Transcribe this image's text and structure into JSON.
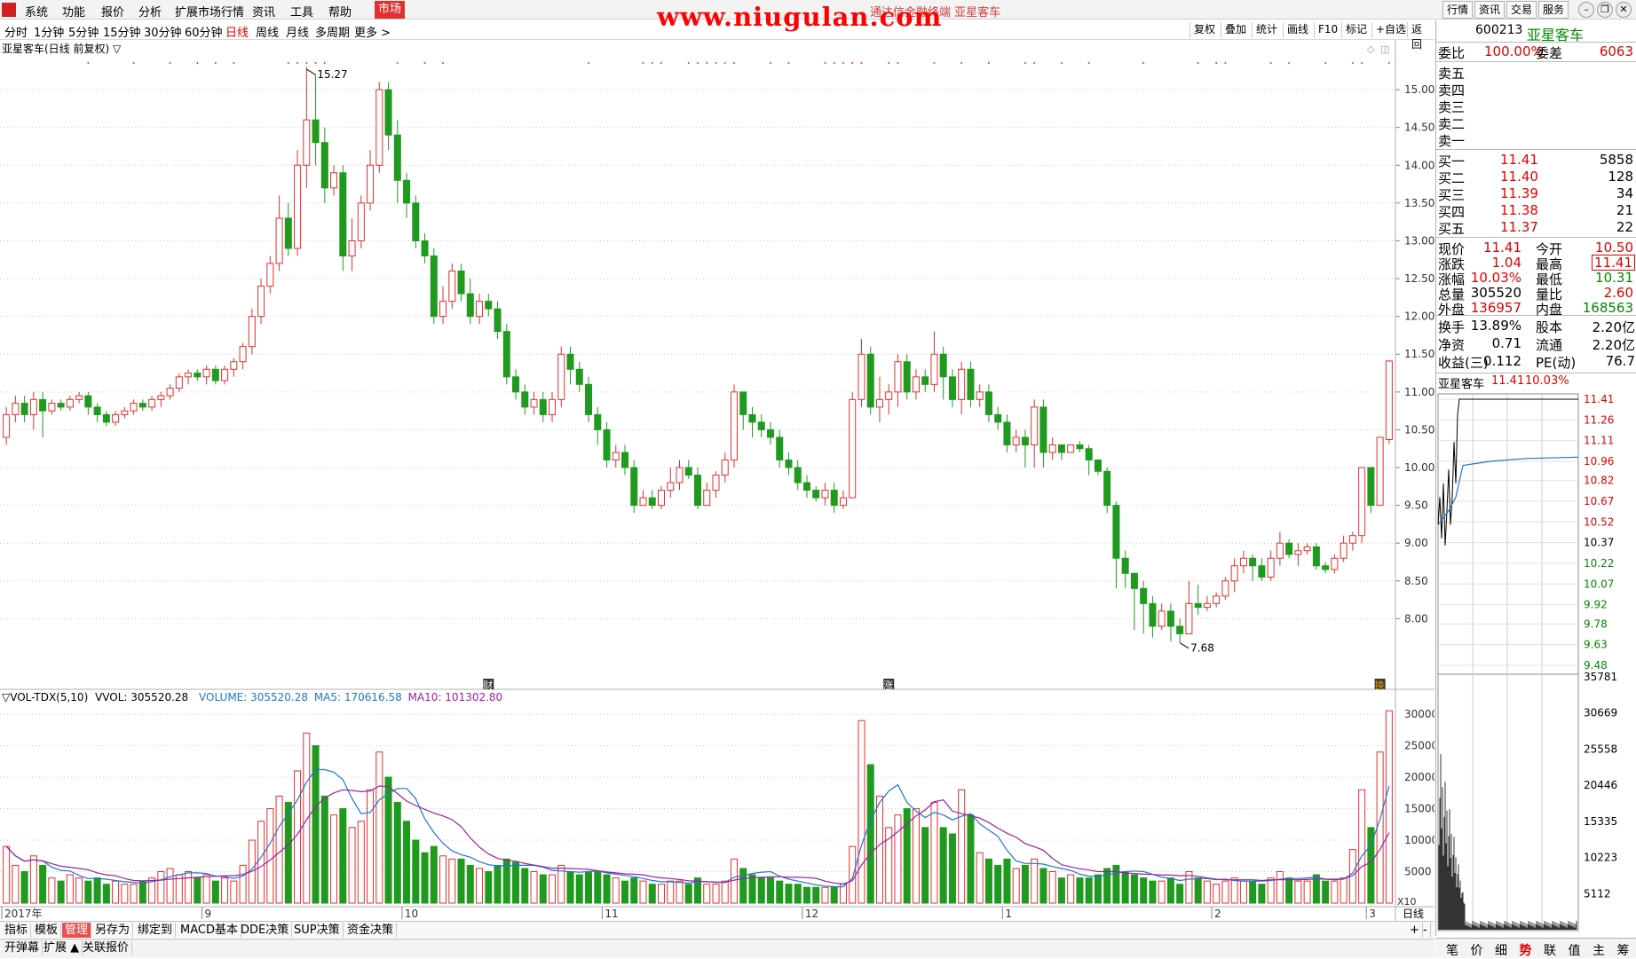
{
  "menu": {
    "items": [
      "系统",
      "功能",
      "报价",
      "分析",
      "扩展市场行情",
      "资讯",
      "工具",
      "帮助"
    ],
    "market": "市场",
    "watermark": "www.niugulan.com",
    "subtitle": "通达信金融终端 亚星客车",
    "right_buttons": [
      "行情",
      "资讯",
      "交易",
      "服务"
    ]
  },
  "toolbar": {
    "periods": [
      "分时",
      "1分钟",
      "5分钟",
      "15分钟",
      "30分钟",
      "60分钟",
      "日线",
      "周线",
      "月线",
      "多周期",
      "更多 >"
    ],
    "active_period": "日线",
    "tools": [
      "复权",
      "叠加",
      "统计",
      "画线",
      "F10",
      "标记",
      "+自选",
      "返回"
    ]
  },
  "chart_title": "亚星客车(日线 前复权) ▽",
  "annotations": {
    "high_label": "15.27",
    "low_label": "7.68",
    "markers": [
      "财",
      "涨",
      "换"
    ]
  },
  "axis": {
    "price_ticks": [
      "15.00",
      "14.50",
      "14.00",
      "13.50",
      "13.00",
      "12.50",
      "12.00",
      "11.50",
      "11.00",
      "10.50",
      "10.00",
      "9.50",
      "9.00",
      "8.50",
      "8.00"
    ],
    "vol_ticks": [
      "30000",
      "25000",
      "20000",
      "15000",
      "10000",
      "5000"
    ],
    "vol_unit": "X10",
    "date_labels": [
      "2017年",
      "9",
      "10",
      "11",
      "12",
      "1",
      "2",
      "3"
    ],
    "period_label": "日线"
  },
  "volume_legend": {
    "name": "▽VOL-TDX(5,10)",
    "vvol": "VVOL: 305520.28",
    "volume": "VOLUME: 305520.28",
    "ma5": "MA5: 170616.58",
    "ma10": "MA10: 101302.80",
    "colors": {
      "vvol": "#000000",
      "volume": "#1f77d0",
      "ma5": "#1f77d0",
      "ma10": "#a020a0"
    }
  },
  "quote": {
    "code": "600213",
    "name": "亚星客车",
    "weibi_label": "委比",
    "weibi": "100.00%",
    "weicha_label": "委差",
    "weicha": "6063",
    "sells": [
      {
        "label": "卖五",
        "price": "",
        "vol": ""
      },
      {
        "label": "卖四",
        "price": "",
        "vol": ""
      },
      {
        "label": "卖三",
        "price": "",
        "vol": ""
      },
      {
        "label": "卖二",
        "price": "",
        "vol": ""
      },
      {
        "label": "卖一",
        "price": "",
        "vol": ""
      }
    ],
    "buys": [
      {
        "label": "买一",
        "price": "11.41",
        "vol": "5858"
      },
      {
        "label": "买二",
        "price": "11.40",
        "vol": "128"
      },
      {
        "label": "买三",
        "price": "11.39",
        "vol": "34"
      },
      {
        "label": "买四",
        "price": "11.38",
        "vol": "21"
      },
      {
        "label": "买五",
        "price": "11.37",
        "vol": "22"
      }
    ],
    "stats": [
      {
        "l1": "现价",
        "v1": "11.41",
        "c1": "red",
        "l2": "今开",
        "v2": "10.50",
        "c2": "red"
      },
      {
        "l1": "涨跌",
        "v1": "1.04",
        "c1": "red",
        "l2": "最高",
        "v2": "11.41",
        "c2": "red"
      },
      {
        "l1": "涨幅",
        "v1": "10.03%",
        "c1": "red",
        "l2": "最低",
        "v2": "10.31",
        "c2": "green"
      },
      {
        "l1": "总量",
        "v1": "305520",
        "c1": "",
        "l2": "量比",
        "v2": "2.60",
        "c2": "red"
      },
      {
        "l1": "外盘",
        "v1": "136957",
        "c1": "red",
        "l2": "内盘",
        "v2": "168563",
        "c2": "green"
      }
    ],
    "stats2": [
      {
        "l1": "换手",
        "v1": "13.89%",
        "l2": "股本",
        "v2": "2.20亿"
      },
      {
        "l1": "净资",
        "v1": "0.71",
        "l2": "流通",
        "v2": "2.20亿"
      },
      {
        "l1": "收益(三)",
        "v1": "0.112",
        "l2": "PE(动)",
        "v2": "76.7"
      }
    ]
  },
  "mini": {
    "name": "亚星客车",
    "price": "11.41",
    "pct": "10.03%",
    "price_ticks": [
      "11.41",
      "11.26",
      "11.11",
      "10.96",
      "10.82",
      "10.67",
      "10.52",
      "10.37",
      "10.22",
      "10.07",
      "9.92",
      "9.78",
      "9.63",
      "9.48"
    ],
    "vol_ticks": [
      "35781",
      "30669",
      "25558",
      "20446",
      "15335",
      "10223",
      "5112"
    ]
  },
  "bottom": {
    "row1": [
      "指标",
      "模板",
      "管理",
      "另存为",
      "绑定到",
      "MACD基本",
      "DDE决策",
      "SUP决策",
      "资金决策"
    ],
    "row1_selected": "管理",
    "row2": [
      "开弹幕",
      "扩展 ▲",
      "关联报价"
    ],
    "right_tabs": [
      "笔",
      "价",
      "细",
      "势",
      "联",
      "值",
      "主",
      "筹"
    ],
    "right_tab_active": "势"
  },
  "chart_data": {
    "type": "candlestick",
    "title": "亚星客车(日线 前复权)",
    "ylim": [
      7.5,
      15.4
    ],
    "vol_ylim": [
      0,
      31000
    ],
    "highest": 15.27,
    "lowest": 7.68,
    "candles": [
      [
        10.4,
        10.7,
        10.3,
        10.8,
        9000
      ],
      [
        10.7,
        10.85,
        10.6,
        10.95,
        6000
      ],
      [
        10.85,
        10.7,
        10.6,
        10.95,
        5000
      ],
      [
        10.7,
        10.9,
        10.5,
        11.0,
        7500
      ],
      [
        10.9,
        10.75,
        10.4,
        11.0,
        6000
      ],
      [
        10.75,
        10.85,
        10.7,
        10.9,
        4000
      ],
      [
        10.85,
        10.8,
        10.75,
        10.9,
        3500
      ],
      [
        10.8,
        10.9,
        10.75,
        10.95,
        4500
      ],
      [
        10.9,
        10.95,
        10.85,
        11.0,
        4000
      ],
      [
        10.95,
        10.8,
        10.7,
        11.0,
        3500
      ],
      [
        10.8,
        10.7,
        10.6,
        10.85,
        4000
      ],
      [
        10.7,
        10.6,
        10.55,
        10.75,
        3000
      ],
      [
        10.6,
        10.7,
        10.55,
        10.75,
        3500
      ],
      [
        10.7,
        10.75,
        10.65,
        10.8,
        3000
      ],
      [
        10.75,
        10.85,
        10.7,
        10.9,
        3000
      ],
      [
        10.85,
        10.8,
        10.75,
        10.9,
        3500
      ],
      [
        10.8,
        10.9,
        10.75,
        10.95,
        4000
      ],
      [
        10.9,
        10.95,
        10.8,
        11.0,
        5000
      ],
      [
        10.95,
        11.05,
        10.9,
        11.1,
        5500
      ],
      [
        11.05,
        11.2,
        11.0,
        11.25,
        4500
      ],
      [
        11.2,
        11.25,
        11.1,
        11.3,
        5000
      ],
      [
        11.25,
        11.2,
        11.15,
        11.3,
        4000
      ],
      [
        11.2,
        11.3,
        11.1,
        11.35,
        4500
      ],
      [
        11.3,
        11.15,
        11.1,
        11.35,
        3500
      ],
      [
        11.15,
        11.3,
        11.1,
        11.35,
        4000
      ],
      [
        11.3,
        11.4,
        11.2,
        11.45,
        3500
      ],
      [
        11.4,
        11.6,
        11.3,
        11.65,
        6000
      ],
      [
        11.6,
        12.0,
        11.5,
        12.1,
        10000
      ],
      [
        12.0,
        12.4,
        11.9,
        12.5,
        13000
      ],
      [
        12.4,
        12.7,
        12.3,
        12.8,
        15000
      ],
      [
        12.7,
        13.3,
        12.6,
        13.6,
        17000
      ],
      [
        13.3,
        12.9,
        12.8,
        13.5,
        16000
      ],
      [
        12.9,
        14.0,
        12.8,
        14.2,
        21000
      ],
      [
        14.0,
        14.6,
        13.7,
        15.3,
        27000
      ],
      [
        14.6,
        14.3,
        14.0,
        15.2,
        25000
      ],
      [
        14.3,
        13.7,
        13.5,
        14.5,
        17000
      ],
      [
        13.7,
        13.9,
        13.6,
        14.0,
        14000
      ],
      [
        13.9,
        12.8,
        12.6,
        14.0,
        15000
      ],
      [
        12.8,
        13.0,
        12.6,
        13.3,
        12000
      ],
      [
        13.0,
        13.5,
        12.9,
        13.6,
        13000
      ],
      [
        13.5,
        14.0,
        13.4,
        14.2,
        18000
      ],
      [
        14.0,
        15.0,
        13.9,
        15.1,
        24000
      ],
      [
        15.0,
        14.4,
        14.2,
        15.1,
        20000
      ],
      [
        14.4,
        13.8,
        13.5,
        14.6,
        16000
      ],
      [
        13.8,
        13.5,
        13.3,
        13.9,
        13000
      ],
      [
        13.5,
        13.0,
        12.9,
        13.6,
        10000
      ],
      [
        13.0,
        12.8,
        12.7,
        13.1,
        8000
      ],
      [
        12.8,
        12.0,
        11.9,
        12.9,
        9000
      ],
      [
        12.0,
        12.2,
        11.9,
        12.4,
        7500
      ],
      [
        12.2,
        12.6,
        12.1,
        12.7,
        7000
      ],
      [
        12.6,
        12.3,
        12.2,
        12.7,
        7000
      ],
      [
        12.3,
        12.0,
        11.9,
        12.5,
        6000
      ],
      [
        12.0,
        12.2,
        11.9,
        12.3,
        5500
      ],
      [
        12.2,
        12.1,
        12.0,
        12.3,
        5000
      ],
      [
        12.1,
        11.8,
        11.7,
        12.2,
        6000
      ],
      [
        11.8,
        11.2,
        11.1,
        11.9,
        7000
      ],
      [
        11.2,
        11.0,
        10.9,
        11.3,
        6500
      ],
      [
        11.0,
        10.8,
        10.7,
        11.1,
        5500
      ],
      [
        10.8,
        10.9,
        10.7,
        11.0,
        5000
      ],
      [
        10.9,
        10.7,
        10.6,
        11.0,
        4500
      ],
      [
        10.7,
        10.9,
        10.6,
        11.0,
        4500
      ],
      [
        10.9,
        11.5,
        10.8,
        11.6,
        6000
      ],
      [
        11.5,
        11.3,
        11.1,
        11.6,
        5000
      ],
      [
        11.3,
        11.1,
        11.0,
        11.4,
        4500
      ],
      [
        11.1,
        10.7,
        10.6,
        11.2,
        5000
      ],
      [
        10.7,
        10.5,
        10.3,
        10.8,
        5000
      ],
      [
        10.5,
        10.1,
        10.0,
        10.6,
        4500
      ],
      [
        10.1,
        10.2,
        10.0,
        10.3,
        4000
      ],
      [
        10.2,
        10.0,
        9.9,
        10.3,
        3500
      ],
      [
        10.0,
        9.5,
        9.4,
        10.1,
        4000
      ],
      [
        9.5,
        9.6,
        9.5,
        9.7,
        3500
      ],
      [
        9.6,
        9.5,
        9.45,
        9.7,
        3000
      ],
      [
        9.5,
        9.7,
        9.45,
        9.75,
        3000
      ],
      [
        9.7,
        9.8,
        9.6,
        10.0,
        3500
      ],
      [
        9.8,
        10.0,
        9.7,
        10.1,
        3500
      ],
      [
        10.0,
        9.9,
        9.85,
        10.1,
        3000
      ],
      [
        9.9,
        9.5,
        9.45,
        10.0,
        4000
      ],
      [
        9.5,
        9.7,
        9.5,
        9.8,
        3000
      ],
      [
        9.7,
        9.9,
        9.6,
        9.95,
        3000
      ],
      [
        9.9,
        10.1,
        9.8,
        10.2,
        3500
      ],
      [
        10.1,
        11.0,
        10.0,
        11.1,
        7000
      ],
      [
        11.0,
        10.7,
        10.5,
        11.0,
        5500
      ],
      [
        10.7,
        10.6,
        10.4,
        10.8,
        4500
      ],
      [
        10.6,
        10.5,
        10.4,
        10.7,
        4000
      ],
      [
        10.5,
        10.4,
        10.3,
        10.6,
        4000
      ],
      [
        10.4,
        10.1,
        10.0,
        10.5,
        3500
      ],
      [
        10.1,
        10.0,
        9.9,
        10.2,
        3000
      ],
      [
        10.0,
        9.8,
        9.7,
        10.1,
        3000
      ],
      [
        9.8,
        9.7,
        9.6,
        9.9,
        2500
      ],
      [
        9.7,
        9.6,
        9.55,
        9.75,
        2500
      ],
      [
        9.6,
        9.7,
        9.5,
        9.8,
        2500
      ],
      [
        9.7,
        9.5,
        9.4,
        9.8,
        2500
      ],
      [
        9.5,
        9.6,
        9.45,
        9.7,
        3000
      ],
      [
        9.6,
        10.9,
        9.6,
        11.0,
        9000
      ],
      [
        10.9,
        11.5,
        10.8,
        11.7,
        29000
      ],
      [
        11.5,
        10.8,
        10.7,
        11.6,
        22000
      ],
      [
        10.8,
        10.9,
        10.6,
        11.2,
        17000
      ],
      [
        10.9,
        11.0,
        10.7,
        11.1,
        12000
      ],
      [
        11.0,
        11.4,
        10.8,
        11.5,
        14000
      ],
      [
        11.4,
        11.0,
        10.9,
        11.5,
        15000
      ],
      [
        11.0,
        11.2,
        10.9,
        11.3,
        15000
      ],
      [
        11.2,
        11.1,
        11.0,
        11.3,
        12000
      ],
      [
        11.1,
        11.5,
        11.0,
        11.8,
        16000
      ],
      [
        11.5,
        11.2,
        10.9,
        11.6,
        12000
      ],
      [
        11.2,
        10.9,
        10.8,
        11.3,
        11000
      ],
      [
        10.9,
        11.3,
        10.7,
        11.4,
        18000
      ],
      [
        11.3,
        10.9,
        10.8,
        11.4,
        14000
      ],
      [
        10.9,
        11.0,
        10.8,
        11.1,
        8000
      ],
      [
        11.0,
        10.7,
        10.6,
        11.1,
        7000
      ],
      [
        10.7,
        10.6,
        10.5,
        10.8,
        6000
      ],
      [
        10.6,
        10.3,
        10.2,
        10.7,
        7000
      ],
      [
        10.3,
        10.4,
        10.2,
        10.5,
        5500
      ],
      [
        10.4,
        10.3,
        10.0,
        10.5,
        6000
      ],
      [
        10.3,
        10.8,
        10.0,
        10.9,
        7000
      ],
      [
        10.8,
        10.2,
        10.0,
        10.9,
        5500
      ],
      [
        10.2,
        10.3,
        10.1,
        10.4,
        5000
      ],
      [
        10.3,
        10.2,
        10.1,
        10.3,
        4000
      ],
      [
        10.2,
        10.3,
        10.2,
        10.3,
        4500
      ],
      [
        10.3,
        10.25,
        10.2,
        10.35,
        4000
      ],
      [
        10.25,
        10.1,
        9.9,
        10.3,
        4000
      ],
      [
        10.1,
        9.95,
        9.9,
        10.05,
        4500
      ],
      [
        9.95,
        9.5,
        9.4,
        10.0,
        5500
      ],
      [
        9.5,
        8.8,
        8.4,
        9.55,
        6000
      ],
      [
        8.8,
        8.6,
        8.4,
        8.9,
        5000
      ],
      [
        8.6,
        8.4,
        7.85,
        8.6,
        4500
      ],
      [
        8.4,
        8.2,
        7.8,
        8.5,
        4000
      ],
      [
        8.2,
        7.9,
        7.75,
        8.3,
        3500
      ],
      [
        7.9,
        8.1,
        7.85,
        8.2,
        3500
      ],
      [
        8.1,
        7.9,
        7.7,
        8.2,
        4000
      ],
      [
        7.9,
        7.8,
        7.68,
        8.0,
        3000
      ],
      [
        7.8,
        8.2,
        7.8,
        8.5,
        5000
      ],
      [
        8.2,
        8.15,
        8.05,
        8.45,
        4000
      ],
      [
        8.15,
        8.2,
        8.1,
        8.3,
        3500
      ],
      [
        8.2,
        8.3,
        8.15,
        8.35,
        3000
      ],
      [
        8.3,
        8.5,
        8.25,
        8.55,
        3500
      ],
      [
        8.5,
        8.7,
        8.35,
        8.8,
        4000
      ],
      [
        8.7,
        8.8,
        8.6,
        8.9,
        3500
      ],
      [
        8.8,
        8.7,
        8.5,
        8.85,
        3500
      ],
      [
        8.7,
        8.55,
        8.5,
        8.8,
        3000
      ],
      [
        8.55,
        8.8,
        8.5,
        8.9,
        4000
      ],
      [
        8.8,
        9.0,
        8.7,
        9.15,
        5000
      ],
      [
        9.0,
        8.85,
        8.8,
        9.05,
        4000
      ],
      [
        8.85,
        8.9,
        8.7,
        9.0,
        3500
      ],
      [
        8.9,
        8.95,
        8.85,
        9.0,
        3500
      ],
      [
        8.95,
        8.7,
        8.65,
        9.0,
        4500
      ],
      [
        8.7,
        8.65,
        8.6,
        8.75,
        3500
      ],
      [
        8.65,
        8.8,
        8.6,
        8.85,
        3500
      ],
      [
        8.8,
        9.0,
        8.75,
        9.1,
        4000
      ],
      [
        9.0,
        9.1,
        8.9,
        9.15,
        8500
      ],
      [
        9.1,
        10.0,
        9.0,
        10.0,
        18000
      ],
      [
        10.0,
        9.5,
        9.4,
        10.0,
        12000
      ],
      [
        9.5,
        10.4,
        9.5,
        10.4,
        24000
      ],
      [
        10.37,
        11.41,
        10.31,
        11.41,
        30550
      ]
    ]
  }
}
